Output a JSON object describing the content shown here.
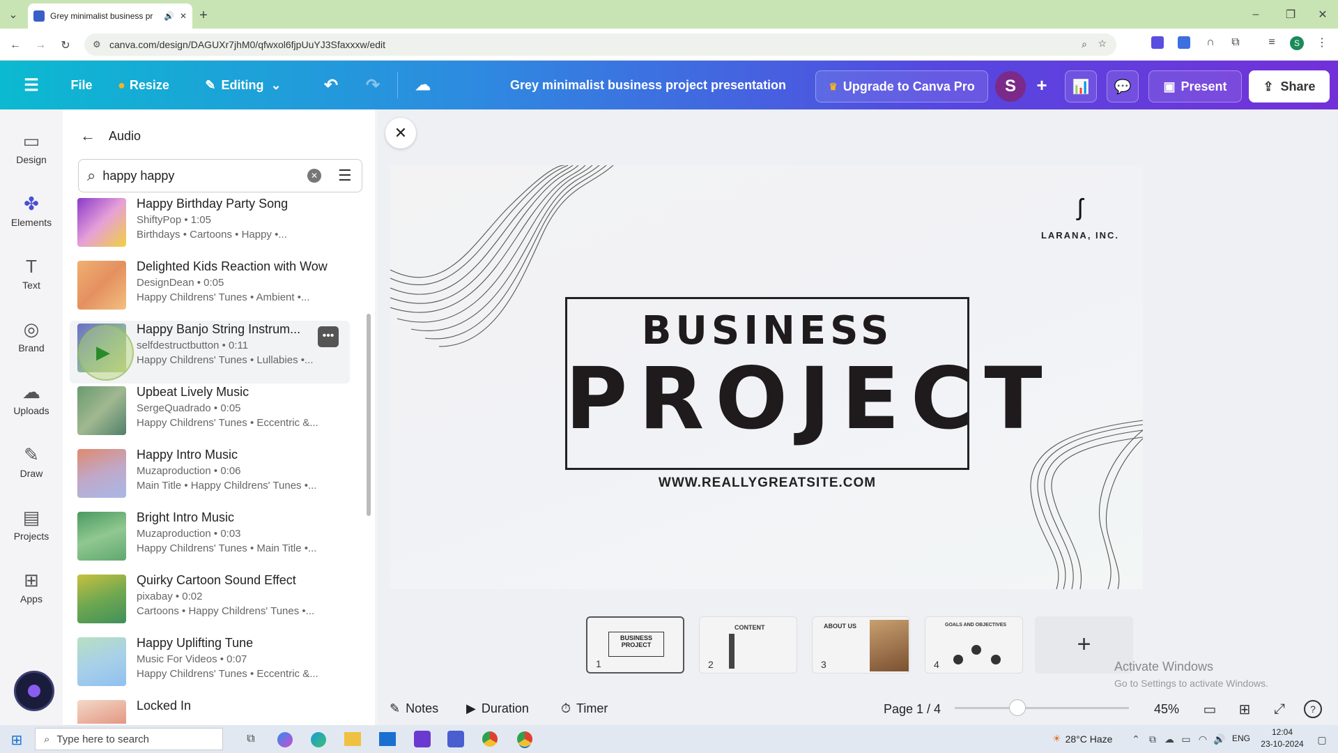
{
  "browser": {
    "tab_title": "Grey minimalist business pr",
    "url": "canva.com/design/DAGUXr7jhM0/qfwxol6fjpUuYJ3Sfaxxxw/edit"
  },
  "header": {
    "file": "File",
    "resize": "Resize",
    "editing": "Editing",
    "doc_title": "Grey minimalist business project presentation",
    "upgrade": "Upgrade to Canva Pro",
    "avatar": "S",
    "present": "Present",
    "share": "Share"
  },
  "rail": [
    {
      "label": "Design",
      "icon": "design-icon"
    },
    {
      "label": "Elements",
      "icon": "elements-icon"
    },
    {
      "label": "Text",
      "icon": "text-icon"
    },
    {
      "label": "Brand",
      "icon": "brand-icon"
    },
    {
      "label": "Uploads",
      "icon": "uploads-icon"
    },
    {
      "label": "Draw",
      "icon": "draw-icon"
    },
    {
      "label": "Projects",
      "icon": "projects-icon"
    },
    {
      "label": "Apps",
      "icon": "apps-icon"
    }
  ],
  "panel": {
    "title": "Audio",
    "search_value": "happy happy",
    "items": [
      {
        "title": "Happy Birthday Party Song",
        "meta": "ShiftyPop • 1:05",
        "tags": "Birthdays • Cartoons • Happy •..."
      },
      {
        "title": "Delighted Kids Reaction with Wow",
        "meta": "DesignDean • 0:05",
        "tags": "Happy Childrens' Tunes • Ambient •..."
      },
      {
        "title": "Happy Banjo String Instrum...",
        "meta": "selfdestructbutton • 0:11",
        "tags": "Happy Childrens' Tunes • Lullabies •..."
      },
      {
        "title": "Upbeat Lively Music",
        "meta": "SergeQuadrado • 0:05",
        "tags": "Happy Childrens' Tunes • Eccentric &..."
      },
      {
        "title": "Happy Intro Music",
        "meta": "Muzaproduction • 0:06",
        "tags": "Main Title • Happy Childrens' Tunes •..."
      },
      {
        "title": "Bright Intro Music",
        "meta": "Muzaproduction • 0:03",
        "tags": "Happy Childrens' Tunes • Main Title •..."
      },
      {
        "title": "Quirky Cartoon Sound Effect",
        "meta": "pixabay • 0:02",
        "tags": "Cartoons • Happy Childrens' Tunes •..."
      },
      {
        "title": "Happy Uplifting Tune",
        "meta": "Music For Videos • 0:07",
        "tags": "Happy Childrens' Tunes • Eccentric &..."
      },
      {
        "title": "Locked In",
        "meta": "",
        "tags": ""
      }
    ]
  },
  "slide": {
    "company": "LARANA, INC.",
    "line1": "BUSINESS",
    "line2": "PROJECT",
    "website": "WWW.REALLYGREATSITE.COM"
  },
  "pages": [
    {
      "num": "1",
      "label": "BUSINESS PROJECT"
    },
    {
      "num": "2",
      "label": "CONTENT"
    },
    {
      "num": "3",
      "label": "ABOUT US"
    },
    {
      "num": "4",
      "label": "GOALS AND OBJECTIVES"
    }
  ],
  "bottom": {
    "notes": "Notes",
    "duration": "Duration",
    "timer": "Timer",
    "page": "Page 1 / 4",
    "zoom": "45%"
  },
  "watermark": {
    "line1": "Activate Windows",
    "line2": "Go to Settings to activate Windows."
  },
  "taskbar": {
    "search_placeholder": "Type here to search",
    "weather": "28°C  Haze",
    "lang": "ENG",
    "time": "12:04",
    "date": "23-10-2024"
  }
}
